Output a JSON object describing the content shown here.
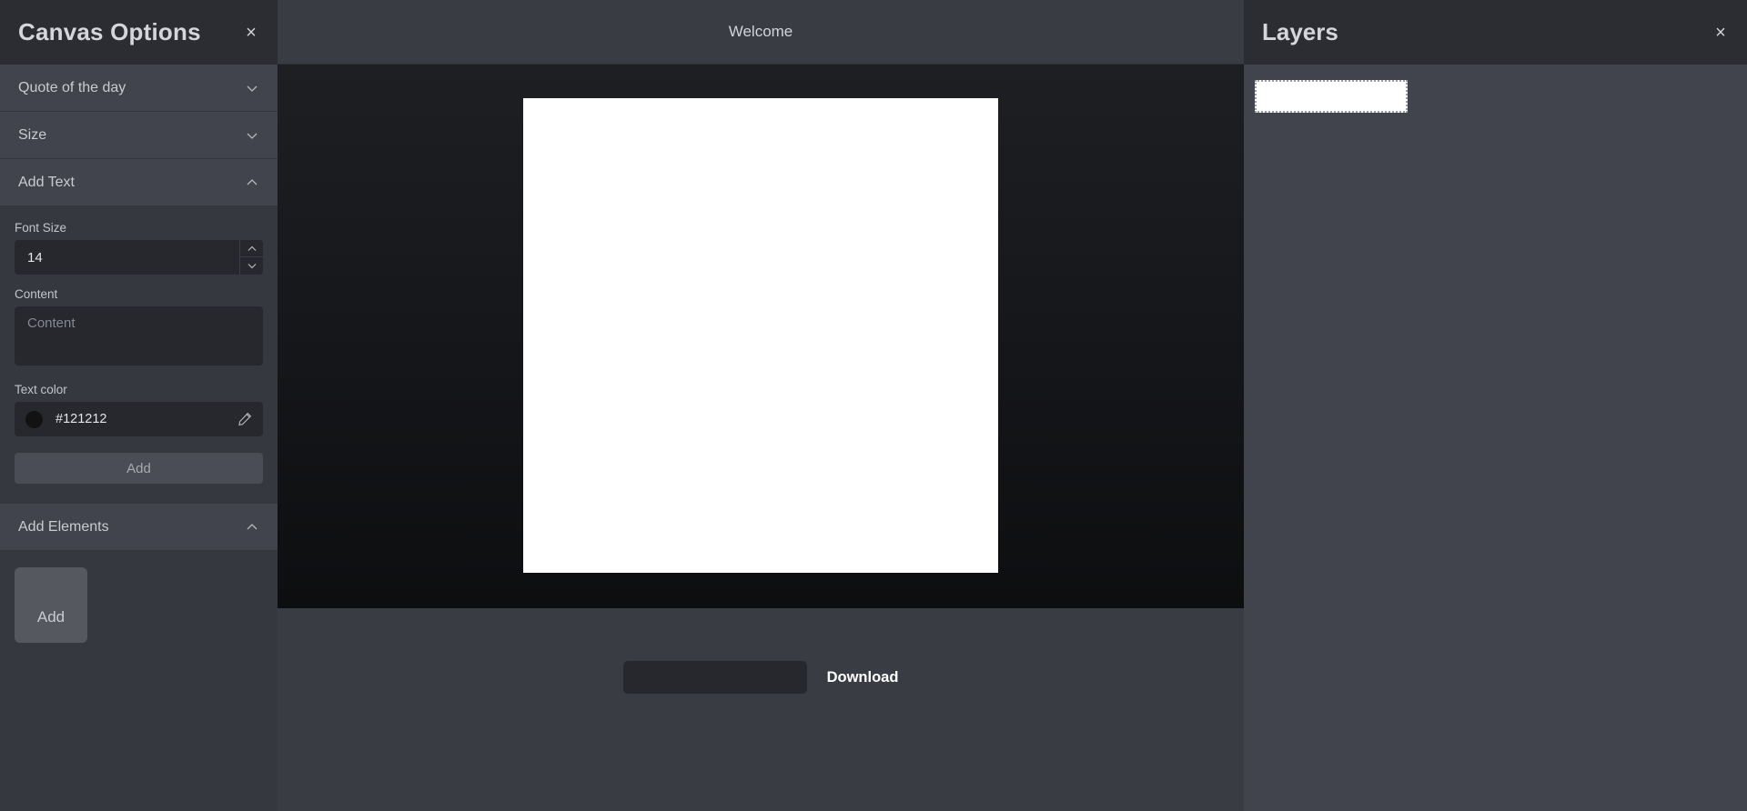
{
  "sidebar": {
    "title": "Canvas Options",
    "close_label": "×",
    "sections": [
      {
        "label": "Quote of the day",
        "expanded": false
      },
      {
        "label": "Size",
        "expanded": false
      },
      {
        "label": "Add Text",
        "expanded": true
      },
      {
        "label": "Add Elements",
        "expanded": true
      }
    ],
    "add_text": {
      "font_size_label": "Font Size",
      "font_size_value": "14",
      "content_label": "Content",
      "content_value": "",
      "content_placeholder": "Content",
      "text_color_label": "Text color",
      "text_color_value": "#121212",
      "text_color_swatch": "#121212",
      "edit_icon": "pencil-icon",
      "add_button_label": "Add"
    },
    "add_elements": {
      "add_tile_label": "Add"
    }
  },
  "center": {
    "title": "Welcome",
    "canvas_color": "#ffffff",
    "download": {
      "filename_value": "",
      "filename_placeholder": "",
      "label": "Download"
    }
  },
  "layers": {
    "title": "Layers",
    "close_label": "×",
    "items": [
      {
        "name": "layer-thumbnail",
        "color": "#ffffff"
      }
    ]
  },
  "icons": {
    "chevron_down": "chevron-down-icon",
    "chevron_up": "chevron-up-icon",
    "close": "close-icon"
  }
}
